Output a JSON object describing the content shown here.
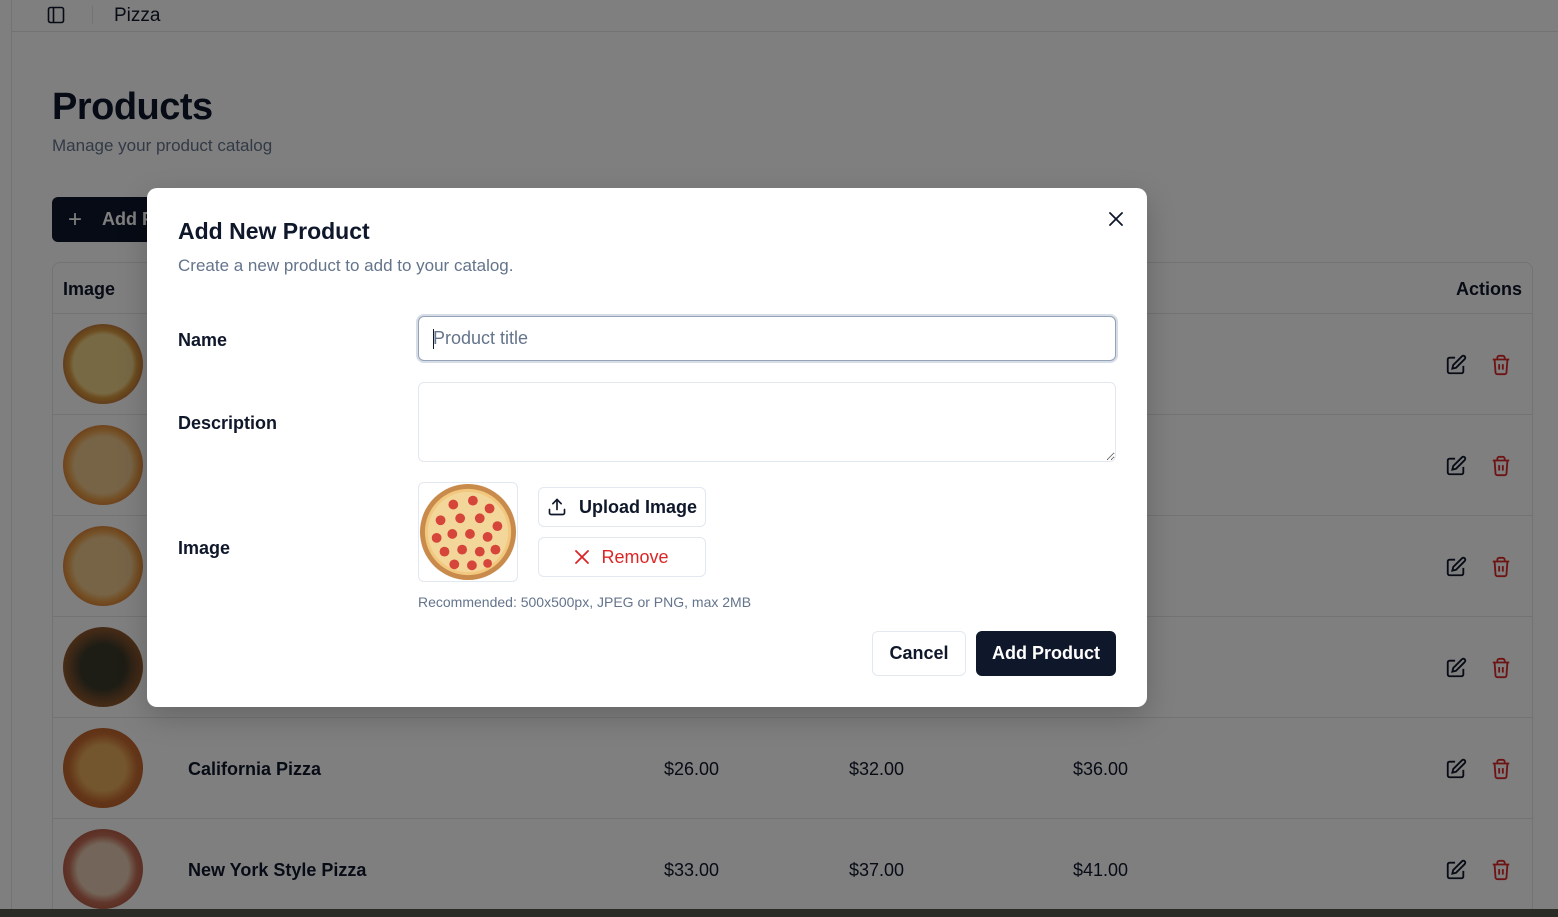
{
  "header": {
    "title": "Pizza"
  },
  "page": {
    "title": "Products",
    "subtitle": "Manage your product catalog",
    "add_button_label": "Add Product"
  },
  "table": {
    "columns": {
      "image": "Image",
      "actions": "Actions"
    },
    "rows": [
      {
        "name": "",
        "price1": "",
        "price2": "",
        "price3": ""
      },
      {
        "name": "",
        "price1": "",
        "price2": "",
        "price3": ""
      },
      {
        "name": "",
        "price1": "",
        "price2": "",
        "price3": ""
      },
      {
        "name": "",
        "price1": "",
        "price2": "",
        "price3": ""
      },
      {
        "name": "California Pizza",
        "price1": "$26.00",
        "price2": "$32.00",
        "price3": "$36.00"
      },
      {
        "name": "New York Style Pizza",
        "price1": "$33.00",
        "price2": "$37.00",
        "price3": "$41.00"
      }
    ]
  },
  "dialog": {
    "title": "Add New Product",
    "description": "Create a new product to add to your catalog.",
    "name_label": "Name",
    "name_placeholder": "Product title",
    "description_label": "Description",
    "image_label": "Image",
    "upload_button": "Upload Image",
    "remove_button": "Remove",
    "image_hint": "Recommended: 500x500px, JPEG or PNG, max 2MB",
    "cancel_button": "Cancel",
    "submit_button": "Add Product"
  },
  "colors": {
    "primary": "#0f172a",
    "danger": "#dc2626",
    "muted": "#64748b",
    "border": "#e2e8f0"
  },
  "icons": [
    "sidebar-toggle-icon",
    "plus-icon",
    "edit-icon",
    "trash-icon",
    "close-icon",
    "upload-icon",
    "x-icon"
  ]
}
